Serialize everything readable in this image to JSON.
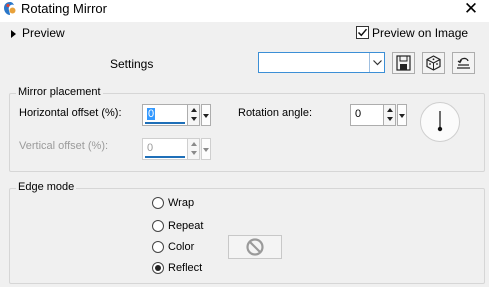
{
  "window": {
    "title": "Rotating Mirror"
  },
  "preview": {
    "label": "Preview",
    "preview_on_image_label": "Preview on Image",
    "preview_on_image_checked": true
  },
  "settings": {
    "label": "Settings",
    "preset_value": ""
  },
  "mirror_placement": {
    "title": "Mirror placement",
    "horizontal_offset_label": "Horizontal offset (%):",
    "horizontal_offset_value": "0",
    "vertical_offset_label": "Vertical offset (%):",
    "vertical_offset_value": "0",
    "rotation_angle_label": "Rotation angle:",
    "rotation_angle_value": "0"
  },
  "edge_mode": {
    "title": "Edge mode",
    "options": [
      "Wrap",
      "Repeat",
      "Color",
      "Reflect"
    ],
    "selected": "Reflect"
  },
  "colors": {
    "accent": "#1e6fb8",
    "panel_bg": "#f0f0f0"
  }
}
